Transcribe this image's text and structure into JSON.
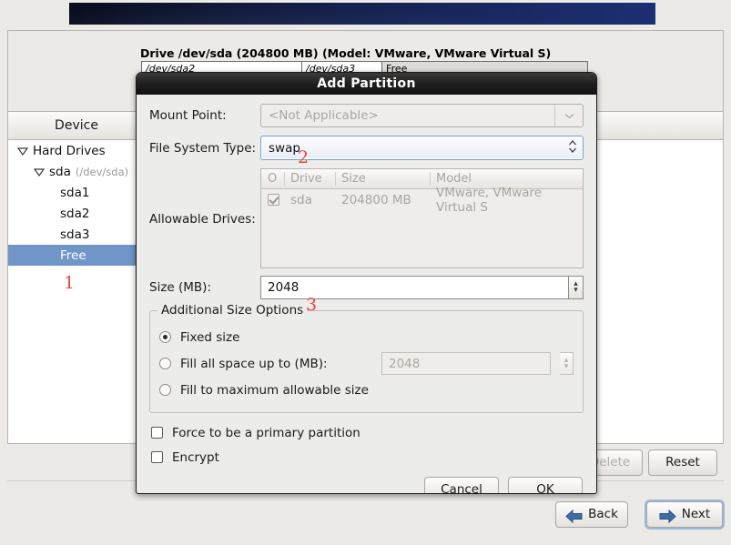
{
  "window": {
    "drive_label": "Drive /dev/sda (204800 MB) (Model: VMware, VMware Virtual S)",
    "partition_bar": [
      {
        "label": "/dev/sda2"
      },
      {
        "label": "/dev/sda3"
      },
      {
        "label": "Free"
      }
    ],
    "tree": {
      "header": "Device",
      "rows": [
        {
          "label": "Hard Drives",
          "sub": ""
        },
        {
          "label": "sda",
          "sub": "(/dev/sda)"
        },
        {
          "label": "sda1",
          "sub": ""
        },
        {
          "label": "sda2",
          "sub": ""
        },
        {
          "label": "sda3",
          "sub": ""
        },
        {
          "label": "Free",
          "sub": ""
        }
      ]
    },
    "buttons": {
      "delete": "Delete",
      "reset": "Reset",
      "back": "Back",
      "next": "Next"
    }
  },
  "annotations": {
    "one": "1",
    "two": "2",
    "three": "3"
  },
  "dialog": {
    "title": "Add Partition",
    "mount_point": {
      "label": "Mount Point:",
      "value": "<Not Applicable>"
    },
    "file_system_type": {
      "label": "File System Type:",
      "value": "swap"
    },
    "allowable_drives": {
      "label": "Allowable Drives:",
      "columns": [
        "O",
        "Drive",
        "Size",
        "Model"
      ],
      "rows": [
        {
          "checked": true,
          "drive": "sda",
          "size": "204800 MB",
          "model": "VMware, VMware Virtual S"
        }
      ]
    },
    "size": {
      "label": "Size (MB):",
      "value": "2048"
    },
    "additional_size_options": {
      "title": "Additional Size Options",
      "options": [
        {
          "label": "Fixed size",
          "selected": true
        },
        {
          "label": "Fill all space up to (MB):",
          "selected": false,
          "value": "2048"
        },
        {
          "label": "Fill to maximum allowable size",
          "selected": false
        }
      ]
    },
    "checkboxes": [
      {
        "label": "Force to be a primary partition",
        "checked": false
      },
      {
        "label": "Encrypt",
        "checked": false
      }
    ],
    "buttons": {
      "cancel": "Cancel",
      "ok": "OK"
    }
  },
  "colors": {
    "selection_blue": "#7096c8",
    "annotation_red": "#e8453c",
    "banner_blue": "#17255a",
    "focus_blue": "#7a9ecb"
  }
}
